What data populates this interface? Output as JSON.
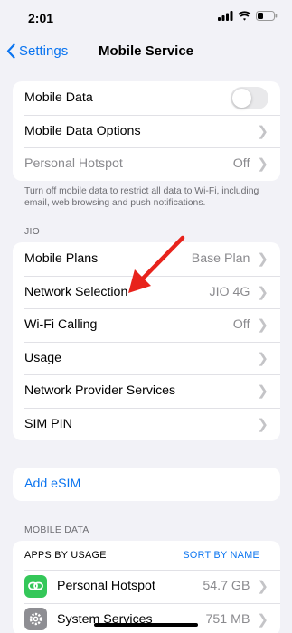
{
  "status": {
    "time": "2:01"
  },
  "nav": {
    "back_label": "Settings",
    "title": "Mobile Service"
  },
  "group1": {
    "mobile_data": "Mobile Data",
    "mobile_data_on": false,
    "mobile_data_options": "Mobile Data Options",
    "personal_hotspot": "Personal Hotspot",
    "personal_hotspot_value": "Off"
  },
  "footnote": "Turn off mobile data to restrict all data to Wi-Fi, including email, web browsing and push notifications.",
  "jio_header": "JIO",
  "carrier_rows": [
    {
      "label": "Mobile Plans",
      "value": "Base Plan"
    },
    {
      "label": "Network Selection",
      "value": "JIO 4G"
    },
    {
      "label": "Wi-Fi Calling",
      "value": "Off"
    },
    {
      "label": "Usage",
      "value": ""
    },
    {
      "label": "Network Provider Services",
      "value": ""
    },
    {
      "label": "SIM PIN",
      "value": ""
    }
  ],
  "esim": {
    "label": "Add eSIM"
  },
  "mobile_data_header": "MOBILE DATA",
  "usage": {
    "apps_by_usage": "APPS BY USAGE",
    "sort_by_name": "SORT BY NAME",
    "apps": [
      {
        "name": "Personal Hotspot",
        "value": "54.7 GB",
        "icon": "link-icon",
        "color": "#34c759"
      },
      {
        "name": "System Services",
        "value": "751 MB",
        "icon": "gear-icon",
        "color": "#8e8e93"
      }
    ]
  },
  "colors": {
    "accent": "#0a74f0",
    "arrow": "#e8231c"
  }
}
